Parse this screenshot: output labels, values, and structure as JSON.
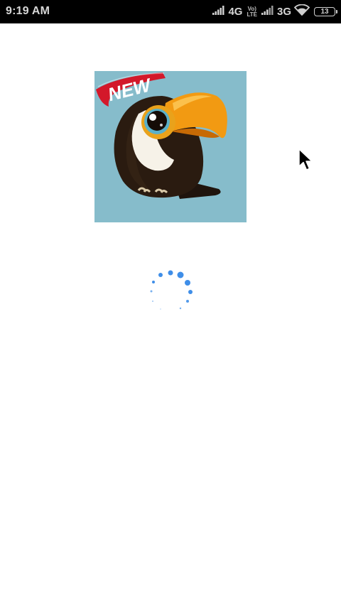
{
  "status_bar": {
    "time": "9:19 AM",
    "network_1": "4G",
    "volte_top": "Vo)",
    "volte_bottom": "LTE",
    "network_2": "3G",
    "battery": "13"
  },
  "splash": {
    "badge_text": "NEW",
    "icon": "toucan-icon",
    "spinner": "loading-spinner"
  },
  "colors": {
    "status_bar_bg": "#000000",
    "screen_bg": "#ffffff",
    "icon_bg": "#86bccb",
    "badge_red": "#d3182a",
    "spinner_blue": "#3f8ee8"
  }
}
